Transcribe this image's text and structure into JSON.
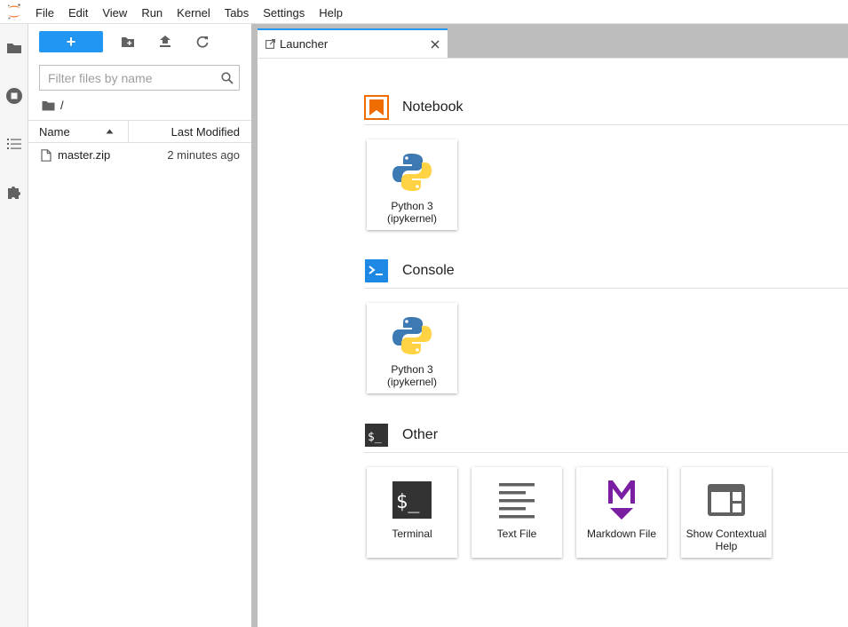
{
  "menubar": {
    "items": [
      "File",
      "Edit",
      "View",
      "Run",
      "Kernel",
      "Tabs",
      "Settings",
      "Help"
    ]
  },
  "activitybar": {
    "icons": [
      "folder-icon",
      "running-icon",
      "toc-icon",
      "extension-icon"
    ]
  },
  "filebrowser": {
    "new_label": "+",
    "filter_placeholder": "Filter files by name",
    "breadcrumb": "/",
    "columns": {
      "name": "Name",
      "modified": "Last Modified"
    },
    "files": [
      {
        "name": "master.zip",
        "modified": "2 minutes ago"
      }
    ]
  },
  "tabs": {
    "launcher": "Launcher"
  },
  "launcher": {
    "notebook": {
      "title": "Notebook",
      "cards": [
        {
          "label": "Python 3 (ipykernel)"
        }
      ]
    },
    "console": {
      "title": "Console",
      "cards": [
        {
          "label": "Python 3 (ipykernel)"
        }
      ]
    },
    "other": {
      "title": "Other",
      "cards": [
        {
          "label": "Terminal"
        },
        {
          "label": "Text File"
        },
        {
          "label": "Markdown File"
        },
        {
          "label": "Show Contextual Help"
        }
      ]
    }
  },
  "colors": {
    "accent": "#2196f3",
    "notebook": "#ef6c00",
    "console": "#1e88e5",
    "markdown": "#7b1fa2",
    "dark_icon": "#333333"
  }
}
